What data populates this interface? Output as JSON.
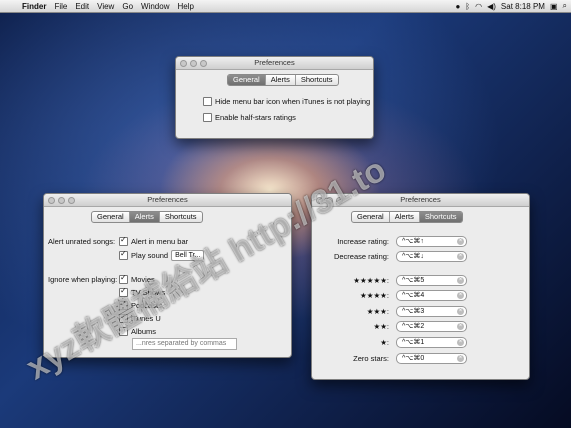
{
  "menubar": {
    "app": "Finder",
    "items": [
      "File",
      "Edit",
      "View",
      "Go",
      "Window",
      "Help"
    ],
    "clock": "Sat 8:18 PM",
    "status_icons": [
      "itunes-icon",
      "bluetooth-icon",
      "wifi-icon",
      "volume-icon",
      "user-icon",
      "spotlight-icon"
    ]
  },
  "win_general": {
    "title": "Preferences",
    "tabs": [
      "General",
      "Alerts",
      "Shortcuts"
    ],
    "selected_tab": "General",
    "options": [
      {
        "label": "Hide menu bar icon when iTunes is not playing",
        "checked": false
      },
      {
        "label": "Enable half-stars ratings",
        "checked": false
      }
    ]
  },
  "win_alerts": {
    "title": "Preferences",
    "tabs": [
      "General",
      "Alerts",
      "Shortcuts"
    ],
    "selected_tab": "Alerts",
    "unrated_label": "Alert unrated songs:",
    "unrated_options": [
      {
        "label": "Alert in menu bar",
        "checked": true
      },
      {
        "label": "Play sound",
        "checked": true
      }
    ],
    "sound_value": "Bell Tr...",
    "ignore_label": "Ignore when playing:",
    "ignore_options": [
      {
        "label": "Movies",
        "checked": true
      },
      {
        "label": "TV Shows",
        "checked": true
      },
      {
        "label": "Podcasts",
        "checked": true
      },
      {
        "label": "iTunes U",
        "checked": true
      },
      {
        "label": "Albums",
        "checked": false
      }
    ],
    "genres_placeholder": "...nres separated by commas"
  },
  "win_shortcuts": {
    "title": "Preferences",
    "tabs": [
      "General",
      "Alerts",
      "Shortcuts"
    ],
    "selected_tab": "Shortcuts",
    "rows": [
      {
        "label": "Increase rating:",
        "key": "^⌥⌘↑"
      },
      {
        "label": "Decrease rating:",
        "key": "^⌥⌘↓"
      },
      {
        "label": "★★★★★:",
        "key": "^⌥⌘5"
      },
      {
        "label": "★★★★:",
        "key": "^⌥⌘4"
      },
      {
        "label": "★★★:",
        "key": "^⌥⌘3"
      },
      {
        "label": "★★:",
        "key": "^⌥⌘2"
      },
      {
        "label": "★:",
        "key": "^⌥⌘1"
      },
      {
        "label": "Zero stars:",
        "key": "^⌥⌘0"
      }
    ]
  },
  "watermark": "xyz軟體補給站 http://31.to"
}
